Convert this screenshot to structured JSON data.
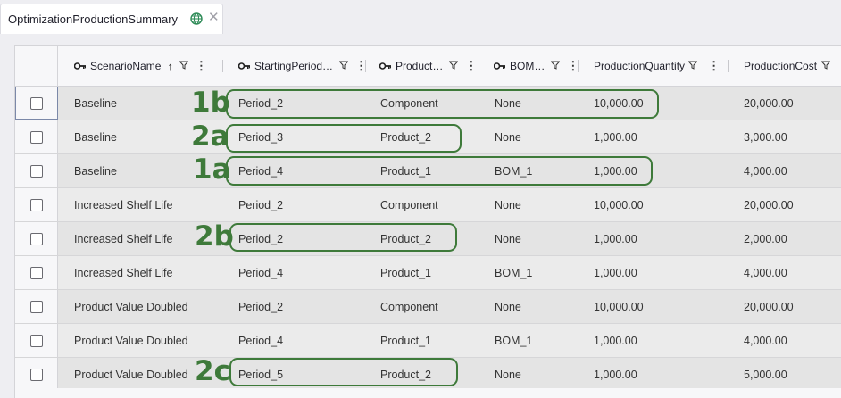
{
  "tab": {
    "title": "OptimizationProductionSummary",
    "globe_icon": "globe-icon",
    "close_icon": "close-icon"
  },
  "columns": [
    {
      "label": "ScenarioName",
      "key": true,
      "sort": "↑"
    },
    {
      "label": "StartingPeriod…",
      "key": true
    },
    {
      "label": "Product…",
      "key": true
    },
    {
      "label": "BOM…",
      "key": true
    },
    {
      "label": "ProductionQuantity",
      "key": false
    },
    {
      "label": "ProductionCost",
      "key": false
    }
  ],
  "rows": [
    {
      "scenario": "Baseline",
      "period": "Period_2",
      "product": "Component",
      "bom": "None",
      "qty": "10,000.00",
      "cost": "20,000.00"
    },
    {
      "scenario": "Baseline",
      "period": "Period_3",
      "product": "Product_2",
      "bom": "None",
      "qty": "1,000.00",
      "cost": "3,000.00"
    },
    {
      "scenario": "Baseline",
      "period": "Period_4",
      "product": "Product_1",
      "bom": "BOM_1",
      "qty": "1,000.00",
      "cost": "4,000.00"
    },
    {
      "scenario": "Increased Shelf Life",
      "period": "Period_2",
      "product": "Component",
      "bom": "None",
      "qty": "10,000.00",
      "cost": "20,000.00"
    },
    {
      "scenario": "Increased Shelf Life",
      "period": "Period_2",
      "product": "Product_2",
      "bom": "None",
      "qty": "1,000.00",
      "cost": "2,000.00"
    },
    {
      "scenario": "Increased Shelf Life",
      "period": "Period_4",
      "product": "Product_1",
      "bom": "BOM_1",
      "qty": "1,000.00",
      "cost": "4,000.00"
    },
    {
      "scenario": "Product Value Doubled",
      "period": "Period_2",
      "product": "Component",
      "bom": "None",
      "qty": "10,000.00",
      "cost": "20,000.00"
    },
    {
      "scenario": "Product Value Doubled",
      "period": "Period_4",
      "product": "Product_1",
      "bom": "BOM_1",
      "qty": "1,000.00",
      "cost": "4,000.00"
    },
    {
      "scenario": "Product Value Doubled",
      "period": "Period_5",
      "product": "Product_2",
      "bom": "None",
      "qty": "1,000.00",
      "cost": "5,000.00"
    }
  ],
  "annotations": [
    "1b",
    "2a",
    "1a",
    "2b",
    "2c"
  ],
  "colors": {
    "annotation": "#3e7a3a",
    "accent_globe": "#2e8b57"
  }
}
